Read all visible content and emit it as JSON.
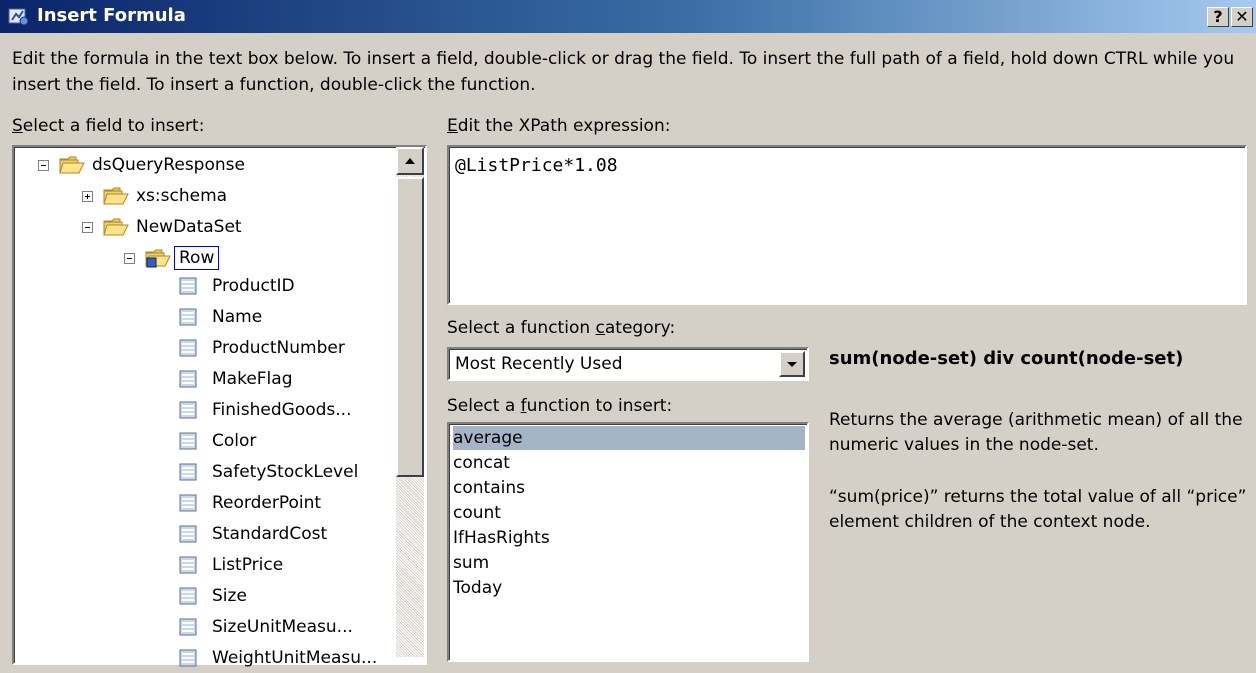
{
  "window": {
    "title": "Insert Formula",
    "help_button": "?",
    "close_button": "✕"
  },
  "instructions": "Edit the formula in the text box below. To insert a field, double-click or drag the field. To insert the full path of a field, hold down CTRL while you insert the field. To insert a function, double-click the function.",
  "field_panel": {
    "label_mnemonic": "S",
    "label_rest": "elect a field to insert:",
    "tree": [
      {
        "label": "dsQueryResponse",
        "type": "folder",
        "expander": "minus"
      },
      {
        "label": "xs:schema",
        "type": "folder",
        "expander": "plus"
      },
      {
        "label": "NewDataSet",
        "type": "folder",
        "expander": "minus"
      },
      {
        "label": "Row",
        "type": "row-folder",
        "expander": "minus",
        "selected": true
      },
      {
        "label": "ProductID",
        "type": "field"
      },
      {
        "label": "Name",
        "type": "field"
      },
      {
        "label": "ProductNumber",
        "type": "field"
      },
      {
        "label": "MakeFlag",
        "type": "field"
      },
      {
        "label": "FinishedGoods...",
        "type": "field"
      },
      {
        "label": "Color",
        "type": "field"
      },
      {
        "label": "SafetyStockLevel",
        "type": "field"
      },
      {
        "label": "ReorderPoint",
        "type": "field"
      },
      {
        "label": "StandardCost",
        "type": "field"
      },
      {
        "label": "ListPrice",
        "type": "field"
      },
      {
        "label": "Size",
        "type": "field"
      },
      {
        "label": "SizeUnitMeasu...",
        "type": "field"
      },
      {
        "label": "WeightUnitMeasu...",
        "type": "field"
      }
    ]
  },
  "xpath_panel": {
    "label_mnemonic": "E",
    "label_rest": "dit the XPath expression:",
    "value": "@ListPrice*1.08"
  },
  "category": {
    "label_pre": "Select a function ",
    "label_mnemonic": "c",
    "label_post": "ategory:",
    "value": "Most Recently Used"
  },
  "functions": {
    "label_pre": "Select a ",
    "label_mnemonic": "f",
    "label_post": "unction to insert:",
    "items": [
      "average",
      "concat",
      "contains",
      "count",
      "IfHasRights",
      "sum",
      "Today"
    ],
    "selected": "average"
  },
  "help": {
    "signature": "sum(node-set) div count(node-set)",
    "description": "Returns the average (arithmetic mean) of all the numeric values in the node-set.",
    "example": "“sum(price)” returns the total value of all “price” element children of the context node."
  },
  "colors": {
    "dialog_bg": "#d4d0c8",
    "titlebar_start": "#0a246a",
    "titlebar_end": "#a6caf0",
    "selection": "#a6b4c8",
    "tree_focus_border": "#0000ff"
  }
}
